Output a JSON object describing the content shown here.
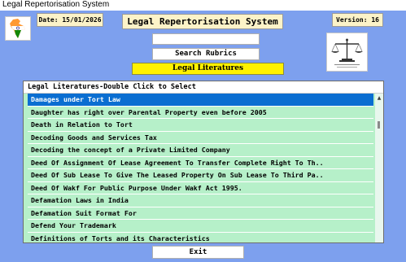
{
  "window": {
    "title": "Legal Repertorisation System"
  },
  "header": {
    "date": "Date: 15/01/2026",
    "title": "Legal Repertorisation System",
    "version": "Version: 16"
  },
  "search": {
    "value": "",
    "button_label": "Search Rubrics"
  },
  "section_heading": "Legal Literatures",
  "list": {
    "header": "Legal Literatures-Double Click to Select",
    "items": [
      "Damages under Tort Law",
      "Daughter has right over Parental Property even before 2005",
      "Death in Relation to Tort",
      "Decoding Goods and Services Tax",
      "Decoding the concept of a Private Limited Company",
      "Deed Of Assignment Of Lease Agreement To Transfer Complete Right To Th..",
      "Deed Of Sub Lease To Give The Leased Property On Sub Lease To Third Pa..",
      "Deed Of Wakf For Public Purpose Under Wakf Act 1995.",
      "Defamation Laws in India",
      "Defamation Suit Format For",
      "Defend Your Trademark",
      "Definitions of Torts and its Characteristics"
    ],
    "selected_index": 0
  },
  "footer": {
    "exit_label": "Exit"
  },
  "colors": {
    "background": "#7da0ee",
    "list_background": "#b6f0c9",
    "selection": "#0a6ed1",
    "heading_yellow": "#fff200",
    "info_box": "#fcf3c8"
  },
  "icons": {
    "left_logo": "india-map-emblem-icon",
    "right_logo": "scales-of-justice-icon"
  }
}
